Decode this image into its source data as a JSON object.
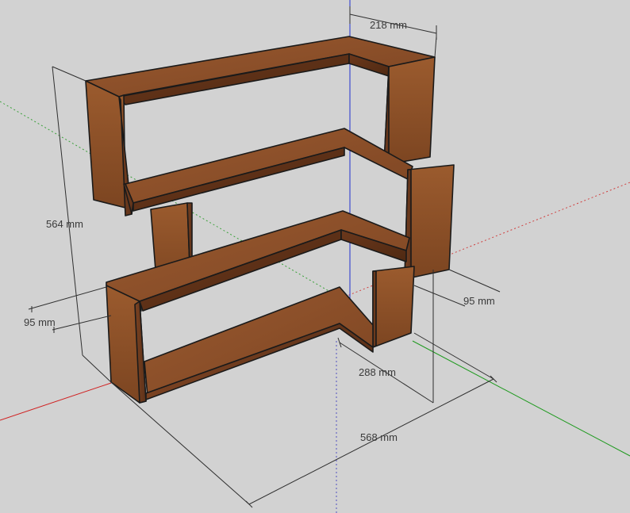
{
  "dimensions": {
    "height": "564 mm",
    "width_front": "568 mm",
    "depth_top": "218 mm",
    "board_width_left": "95 mm",
    "board_width_right": "95 mm",
    "inner_depth": "288 mm"
  },
  "colors": {
    "background": "#d2d2d2",
    "wood_top": "#8a4e2a",
    "wood_front": "#6d3a1e",
    "wood_side": "#8e5328",
    "wood_inner": "#5a2f17",
    "edge": "#1a1a1a",
    "axis_red": "#d02020",
    "axis_green": "#1f9a1f",
    "axis_blue": "#2030d0"
  }
}
